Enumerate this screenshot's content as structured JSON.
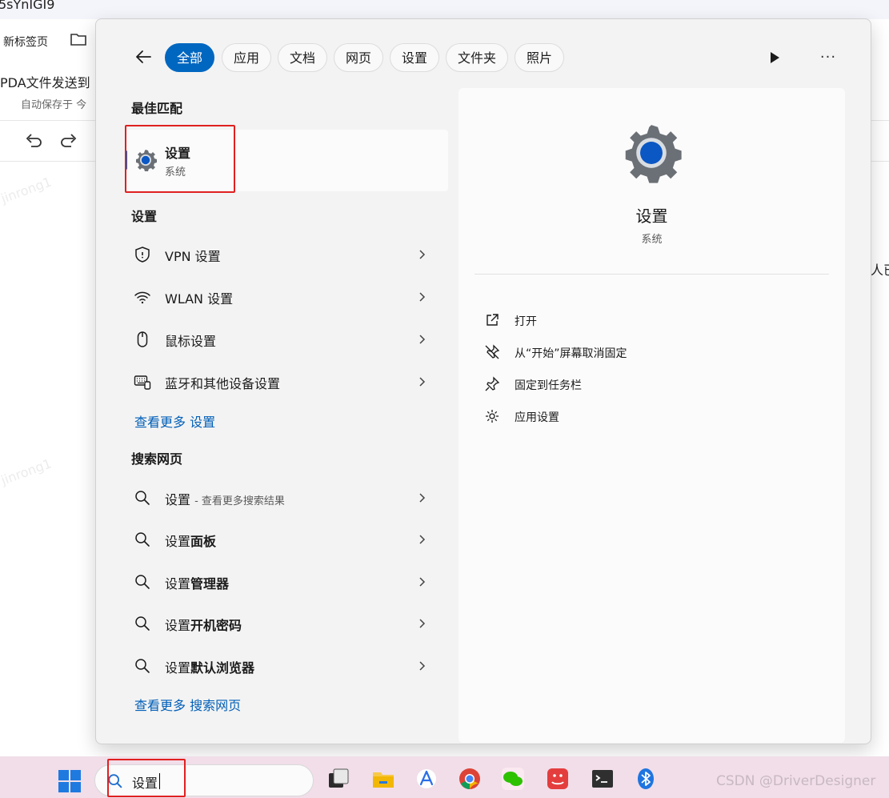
{
  "background": {
    "window_title": "5sYnIGI9",
    "bookmark_label": "新标签页",
    "doc_title": "PDA文件发送到",
    "autosave": "自动保存于 今",
    "right_snippet": "人已",
    "watermark": "jinrong1"
  },
  "search_panel": {
    "tabs": [
      "全部",
      "应用",
      "文档",
      "网页",
      "设置",
      "文件夹",
      "照片"
    ],
    "best_match": {
      "header": "最佳匹配",
      "name": "设置",
      "type": "系统"
    },
    "settings_section": {
      "header": "设置",
      "items": [
        {
          "icon": "shield-icon",
          "label": "VPN 设置"
        },
        {
          "icon": "wifi-icon",
          "label": "WLAN 设置"
        },
        {
          "icon": "mouse-icon",
          "label": "鼠标设置"
        },
        {
          "icon": "keyboard-icon",
          "label": "蓝牙和其他设备设置"
        }
      ],
      "see_more": "查看更多 设置"
    },
    "web_section": {
      "header": "搜索网页",
      "first_item": {
        "query": "设置",
        "suffix": "- 查看更多搜索结果"
      },
      "items": [
        {
          "prefix": "设置",
          "bold": "面板"
        },
        {
          "prefix": "设置",
          "bold": "管理器"
        },
        {
          "prefix": "设置",
          "bold": "开机密码"
        },
        {
          "prefix": "设置",
          "bold": "默认浏览器"
        }
      ],
      "see_more": "查看更多 搜索网页"
    },
    "detail": {
      "name": "设置",
      "type": "系统",
      "actions": [
        {
          "icon": "open-external-icon",
          "label": "打开"
        },
        {
          "icon": "unpin-icon",
          "label": "从“开始”屏幕取消固定"
        },
        {
          "icon": "pin-icon",
          "label": "固定到任务栏"
        },
        {
          "icon": "gear-icon",
          "label": "应用设置"
        }
      ]
    }
  },
  "taskbar": {
    "search_value": "设置",
    "watermark": "CSDN @DriverDesigner"
  },
  "colors": {
    "accent": "#0067c0",
    "link": "#005fb8",
    "highlight_box": "#e02020",
    "taskbar": "#f1dee9"
  }
}
